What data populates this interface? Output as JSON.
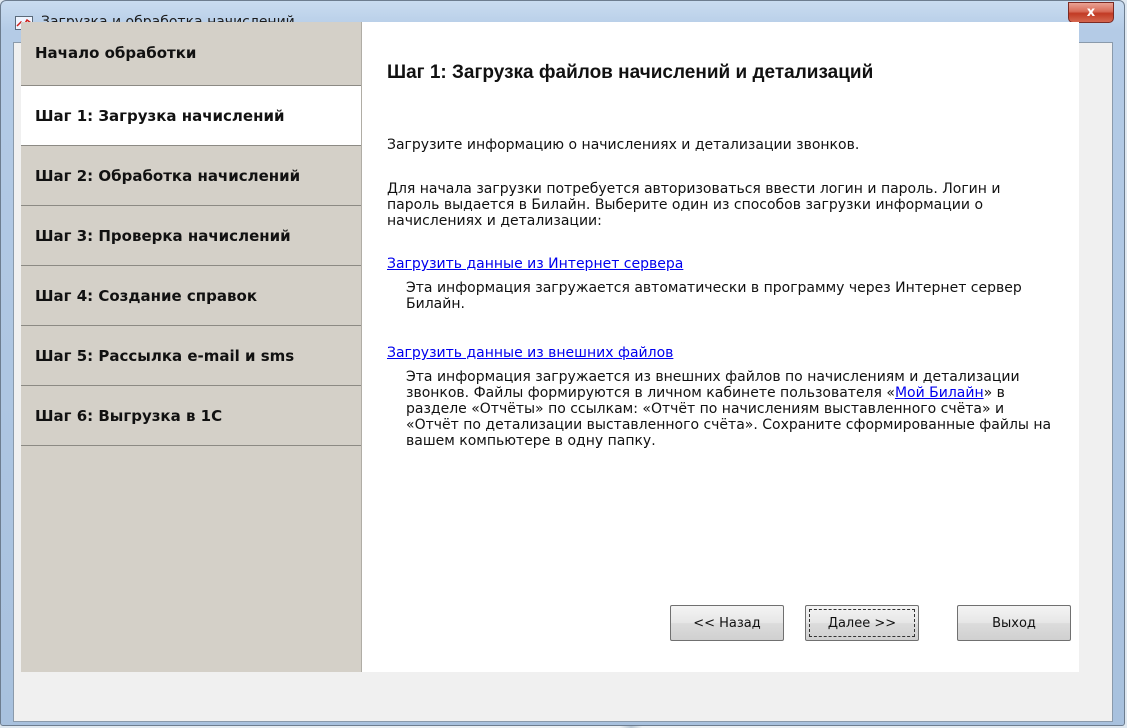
{
  "window": {
    "title": "Загрузка и обработка начислений",
    "close_label": "x"
  },
  "sidebar": {
    "items": [
      {
        "label": "Начало обработки",
        "active": false
      },
      {
        "label": "Шаг 1: Загрузка начислений",
        "active": true
      },
      {
        "label": "Шаг 2: Обработка начислений",
        "active": false
      },
      {
        "label": "Шаг 3: Проверка начислений",
        "active": false
      },
      {
        "label": "Шаг 4: Создание справок",
        "active": false
      },
      {
        "label": "Шаг 5: Рассылка e-mail и sms",
        "active": false
      },
      {
        "label": "Шаг 6: Выгрузка в 1С",
        "active": false
      }
    ]
  },
  "content": {
    "title": "Шаг 1: Загрузка файлов начислений и детализаций",
    "intro": "Загрузите информацию о начислениях и детализации звонков.",
    "instructions": "Для начала загрузки потребуется авторизоваться ввести логин и пароль. Логин и пароль выдается в Билайн. Выберите один из способов загрузки информации о начислениях и детализации:",
    "option1": {
      "link": "Загрузить данные из Интернет сервера",
      "desc": "Эта информация загружается автоматически в программу через Интернет сервер Билайн."
    },
    "option2": {
      "link": "Загрузить данные из внешних файлов",
      "desc_before": "Эта информация загружается из внешних файлов по начислениям и детализации звонков. Файлы формируются в личном кабинете пользователя «",
      "desc_link": "Мой Билайн",
      "desc_after": "» в разделе «Отчёты» по ссылкам: «Отчёт по начислениям выставленного счёта» и «Отчёт по детализации выставленного счёта». Сохраните сформированные файлы на вашем компьютере в одну папку."
    }
  },
  "buttons": {
    "back": "<< Назад",
    "next": "Далее >>",
    "exit": "Выход"
  }
}
